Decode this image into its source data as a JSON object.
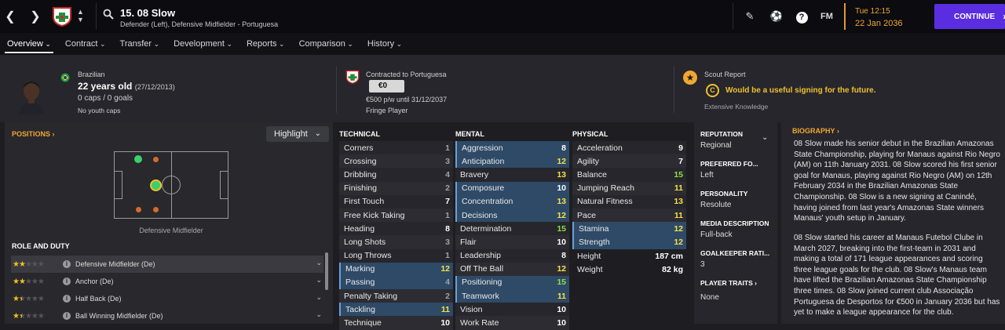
{
  "topbar": {
    "player_title": "15. 08 Slow",
    "player_positions": "Defender (Left), Defensive Midfielder - Portuguesa",
    "date_day": "Tue 12:15",
    "date_full": "22 Jan 2036",
    "continue_label": "CONTINUE",
    "fm_label": "FM"
  },
  "tabs": [
    "Overview",
    "Contract",
    "Transfer",
    "Development",
    "Reports",
    "Comparison",
    "History"
  ],
  "header": {
    "nationality": "Brazilian",
    "age": "22 years old",
    "dob": "(27/12/2013)",
    "caps": "0 caps / 0 goals",
    "youth_caps": "No youth caps",
    "contract_label": "Contracted to Portuguesa",
    "value": "€0",
    "wage": "€500 p/w until 31/12/2037",
    "squad_status": "Fringe Player",
    "scout_title": "Scout Report",
    "scout_grade": "C",
    "scout_text": "Would be a useful signing for the future.",
    "scout_knowledge": "Extensive Knowledge"
  },
  "positions": {
    "title": "POSITIONS",
    "highlight_label": "Highlight",
    "position_name": "Defensive Midfielder",
    "role_title": "ROLE AND DUTY",
    "roles": [
      {
        "label": "Defensive Midfielder (De)",
        "stars": 2
      },
      {
        "label": "Anchor (De)",
        "stars": 2
      },
      {
        "label": "Half Back (De)",
        "stars": 1.5
      },
      {
        "label": "Ball Winning Midfielder (De)",
        "stars": 1.5
      }
    ]
  },
  "technical": {
    "title": "TECHNICAL",
    "rows": [
      {
        "name": "Corners",
        "value": "1"
      },
      {
        "name": "Crossing",
        "value": "3"
      },
      {
        "name": "Dribbling",
        "value": "4"
      },
      {
        "name": "Finishing",
        "value": "2"
      },
      {
        "name": "First Touch",
        "value": "7"
      },
      {
        "name": "Free Kick Taking",
        "value": "1"
      },
      {
        "name": "Heading",
        "value": "8"
      },
      {
        "name": "Long Shots",
        "value": "3"
      },
      {
        "name": "Long Throws",
        "value": "1"
      },
      {
        "name": "Marking",
        "value": "12"
      },
      {
        "name": "Passing",
        "value": "4"
      },
      {
        "name": "Penalty Taking",
        "value": "2"
      },
      {
        "name": "Tackling",
        "value": "11"
      },
      {
        "name": "Technique",
        "value": "10"
      }
    ]
  },
  "mental": {
    "title": "MENTAL",
    "rows": [
      {
        "name": "Aggression",
        "value": "8"
      },
      {
        "name": "Anticipation",
        "value": "12"
      },
      {
        "name": "Bravery",
        "value": "13"
      },
      {
        "name": "Composure",
        "value": "10"
      },
      {
        "name": "Concentration",
        "value": "13"
      },
      {
        "name": "Decisions",
        "value": "12"
      },
      {
        "name": "Determination",
        "value": "15"
      },
      {
        "name": "Flair",
        "value": "10"
      },
      {
        "name": "Leadership",
        "value": "8"
      },
      {
        "name": "Off The Ball",
        "value": "12"
      },
      {
        "name": "Positioning",
        "value": "15"
      },
      {
        "name": "Teamwork",
        "value": "11"
      },
      {
        "name": "Vision",
        "value": "10"
      },
      {
        "name": "Work Rate",
        "value": "10"
      }
    ]
  },
  "physical": {
    "title": "PHYSICAL",
    "rows": [
      {
        "name": "Acceleration",
        "value": "9"
      },
      {
        "name": "Agility",
        "value": "7"
      },
      {
        "name": "Balance",
        "value": "15"
      },
      {
        "name": "Jumping Reach",
        "value": "11"
      },
      {
        "name": "Natural Fitness",
        "value": "13"
      },
      {
        "name": "Pace",
        "value": "11"
      },
      {
        "name": "Stamina",
        "value": "12"
      },
      {
        "name": "Strength",
        "value": "12"
      }
    ],
    "height_label": "Height",
    "height": "187 cm",
    "weight_label": "Weight",
    "weight": "82 kg"
  },
  "side": {
    "reputation_label": "REPUTATION",
    "reputation": "Regional",
    "foot_label": "PREFERRED FO...",
    "foot": "Left",
    "personality_label": "PERSONALITY",
    "personality": "Resolute",
    "media_label": "MEDIA DESCRIPTION",
    "media": "Full-back",
    "gk_label": "GOALKEEPER RATI...",
    "gk": "3",
    "traits_label": "PLAYER TRAITS",
    "traits": "None"
  },
  "bio": {
    "title": "BIOGRAPHY",
    "p1": "08 Slow made his senior debut in the Brazilian Amazonas State Championship, playing for Manaus against Rio Negro (AM) on 11th January 2031. 08 Slow scored his first senior goal for Manaus, playing against Rio Negro (AM) on 12th February 2034 in the Brazilian Amazonas State Championship. 08 Slow is a new signing at Canindé, having joined from last year's Amazonas State winners Manaus' youth setup in January.",
    "p2": "08 Slow started his career at Manaus Futebol Clube in March 2027, breaking into the first-team in 2031 and making a total of 171 league appearances and scoring three league goals for the club. 08 Slow's Manaus team have lifted the Brazilian Amazonas State Championship three times. 08 Slow joined current club Associação Portuguesa de Desportos for €500 in January 2036 but has yet to make a league appearance for the club."
  },
  "colors": {
    "accent": "#f0a830",
    "continue": "#5a2ee0",
    "highlight_row": "#2e4a66",
    "good": "#8ce04a",
    "warn": "#f6e04a"
  }
}
